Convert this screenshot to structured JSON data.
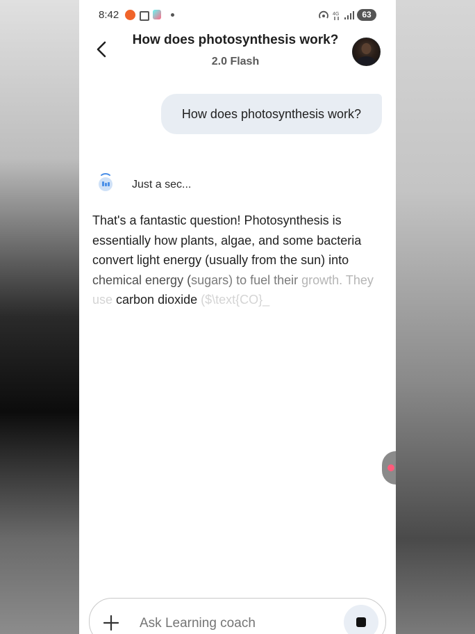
{
  "status_bar": {
    "time": "8:42",
    "battery": "63"
  },
  "header": {
    "title": "How does photosynthesis work?",
    "model": "2.0 Flash"
  },
  "conversation": {
    "user_message": "How does photosynthesis work?",
    "thinking_text": "Just a sec...",
    "answer_segments": [
      "That's a fantastic question! Photosynthesis is essentially how plants, algae, and some bacteria convert light energy (usually from the sun) into ",
      "chemical energy (",
      "sugars) to fuel their ",
      "growth. They ",
      "use ",
      "carbon dioxide",
      " ($\\text{CO}_"
    ]
  },
  "input": {
    "placeholder": "Ask Learning coach"
  },
  "colors": {
    "bubble_bg": "#e8edf3",
    "accent_blue": "#4a8fe7",
    "handle_dot": "#ff5a7a"
  }
}
